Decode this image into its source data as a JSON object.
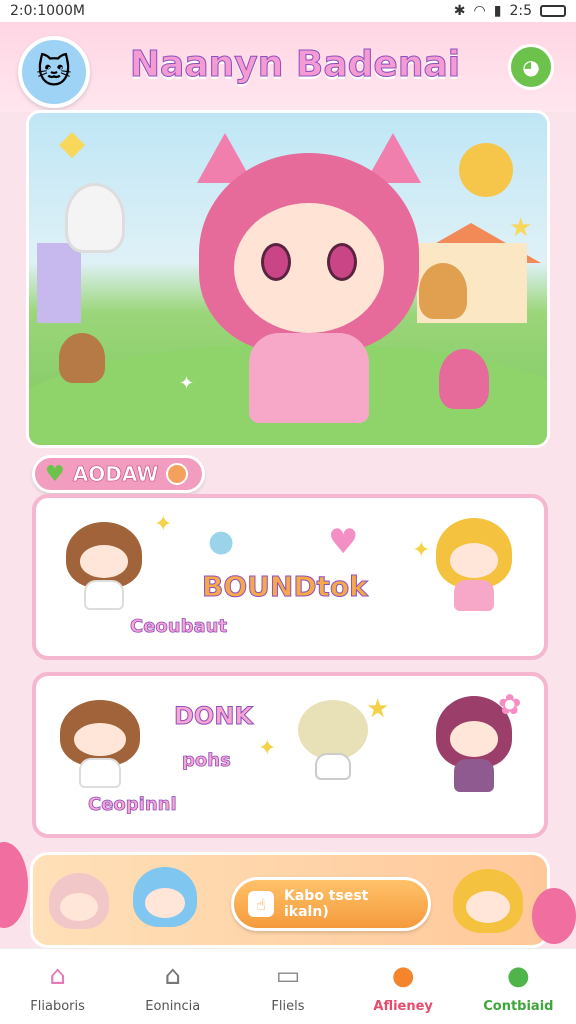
{
  "status_bar": {
    "time_left": "2:0:1000M",
    "time_right": "2:5"
  },
  "header": {
    "title": "Naanyn Badenai"
  },
  "section": {
    "label": "AODAW"
  },
  "card1": {
    "word_center": "BOUNDtok",
    "caption": "Ceoubaut"
  },
  "card2": {
    "word_top": "DONK",
    "word_mid": "pohs",
    "caption": "Ceopinnl"
  },
  "cta": {
    "line1": "Kabo tsest",
    "line2": "ikaln)"
  },
  "nav": [
    {
      "label": "Fliaboris",
      "icon": "house-pink-icon"
    },
    {
      "label": "Eonincia",
      "icon": "house-outline-icon"
    },
    {
      "label": "Fliels",
      "icon": "folder-icon"
    },
    {
      "label": "Aflieney",
      "icon": "fruit-icon"
    },
    {
      "label": "Contbiaid",
      "icon": "person-icon"
    }
  ],
  "colors": {
    "accent_pink": "#f29cc0",
    "accent_orange": "#f59a3c",
    "accent_green": "#6cc24a"
  }
}
